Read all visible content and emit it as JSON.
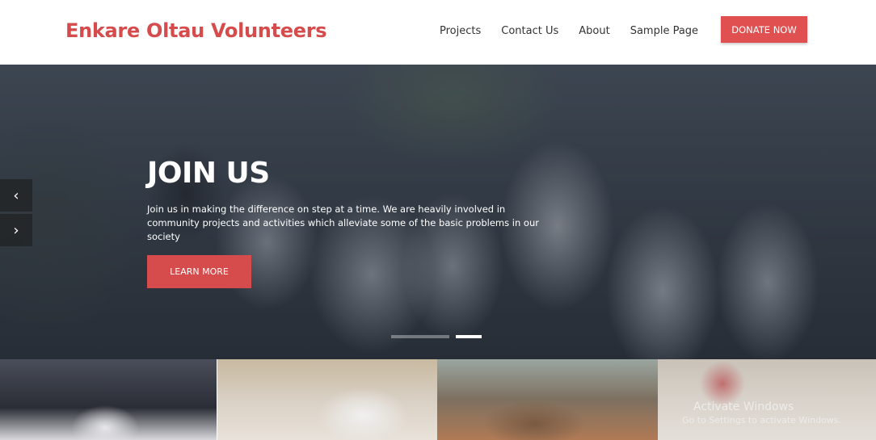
{
  "header": {
    "brand": "Enkare Oltau Volunteers",
    "nav": [
      "Projects",
      "Contact Us",
      "About",
      "Sample Page"
    ],
    "donate_label": "DONATE NOW"
  },
  "hero": {
    "title": "JOIN US",
    "text": "Join us in making the difference on step at a time. We are heavily involved in community projects and activities which alleviate some of the basic problems in our society",
    "button_label": "LEARN MORE",
    "prev_icon": "‹",
    "next_icon": "›",
    "slide_count": 2,
    "active_slide": 2
  },
  "thumbnails": [
    "volunteers-group-photo",
    "doing-good-event-photo",
    "community-work-photo",
    "outdoor-cleanup-photo"
  ],
  "overlay": {
    "windows_activation_line1": "Activate Windows",
    "windows_activation_line2": "Go to Settings to activate Windows."
  },
  "colors": {
    "brand": "#d64b4b",
    "donate_button": "#e05050"
  }
}
